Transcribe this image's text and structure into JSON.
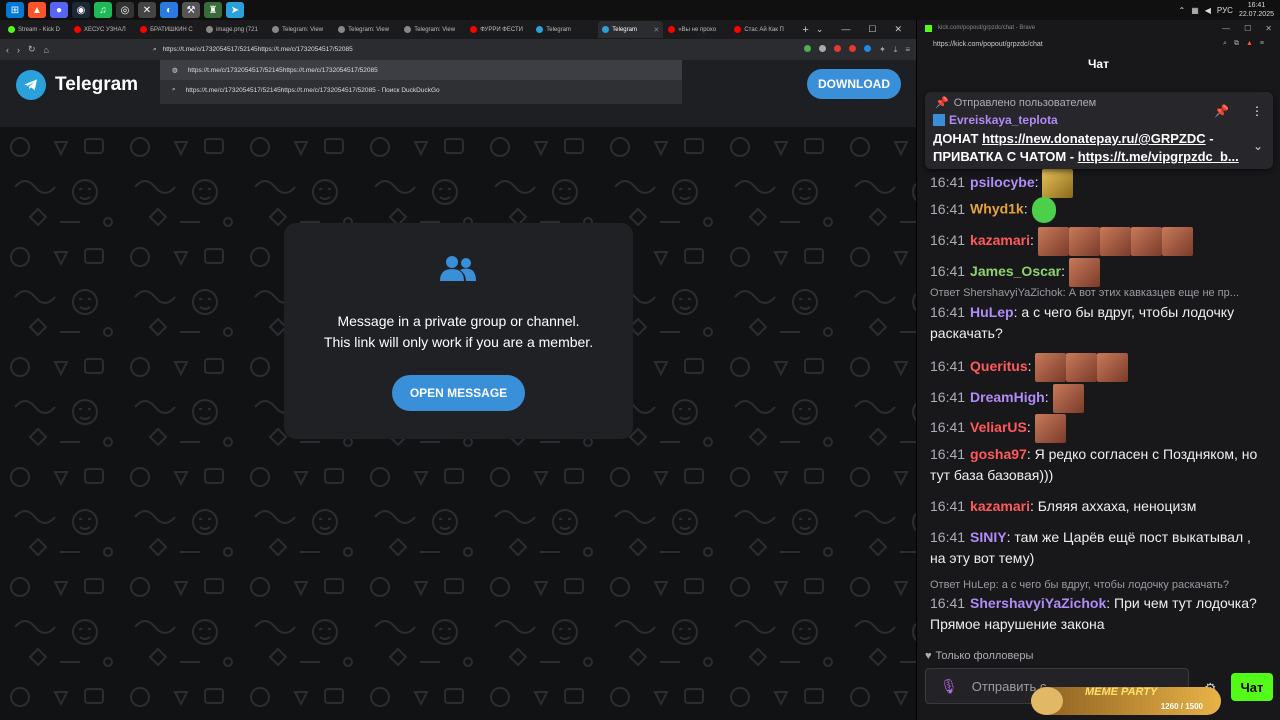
{
  "taskbar": {
    "time": "16:41",
    "date": "22.07.2025",
    "lang": "РУС"
  },
  "left_browser": {
    "tabs": [
      {
        "label": "Stream - Kick D",
        "color": "#53fc18"
      },
      {
        "label": "ХЕСУС УЗНАЛ",
        "color": "#ff0000"
      },
      {
        "label": "БРАТИШКИН С",
        "color": "#ff0000"
      },
      {
        "label": "image.png (721",
        "color": "#888888"
      },
      {
        "label": "Telegram: View",
        "color": "#888888"
      },
      {
        "label": "Telegram: View",
        "color": "#888888"
      },
      {
        "label": "Telegram: View",
        "color": "#888888"
      },
      {
        "label": "ФУРРИ ФЕСТИ",
        "color": "#ff0000"
      },
      {
        "label": "Telegram",
        "color": "#2aa1da"
      },
      {
        "label": "Telegram",
        "color": "#2aa1da"
      },
      {
        "label": "«Вы не прохо",
        "color": "#ff0000"
      },
      {
        "label": "Стас Ай Как П",
        "color": "#ff0000"
      }
    ],
    "address": "https://t.me/c/1732054517/52145https://t.me/c/1732054517/52085",
    "suggestions": [
      "https://t.me/c/1732054517/52145https://t.me/c/1732054517/52085",
      "https://t.me/c/1732054517/52145https://t.me/c/1732054517/52085 - Поиск DuckDuckGo"
    ],
    "page": {
      "brand": "Telegram",
      "download": "DOWNLOAD",
      "card_line1": "Message in a private group or channel.",
      "card_line2": "This link will only work if you are a member.",
      "open_button": "OPEN MESSAGE"
    }
  },
  "right_browser": {
    "title": "kick.com/popout/grpzdc/chat - Brave",
    "url": "https://kick.com/popout/grpzdc/chat",
    "chat_title": "Чат",
    "pinned": {
      "header": "Отправлено пользователем",
      "user": "Evreiskaya_teplota",
      "text_prefix": "ДОНАТ",
      "link1": "https://new.donatepay.ru/@GRPZDC",
      "text_mid": " - ПРИВАТКА С ЧАТОМ - ",
      "link2": "https://t.me/vipgrpzdc_b..."
    },
    "messages": [
      {
        "time": "16:41",
        "user": "psilocybe",
        "color": "#b08cf7",
        "text": "",
        "emotes": [
          "gold"
        ]
      },
      {
        "time": "16:41",
        "user": "Whyd1k",
        "color": "#e6a23c",
        "text": "",
        "emotes": [
          "green"
        ]
      },
      {
        "time": "16:41",
        "user": "kazamari",
        "color": "#ff5a5a",
        "text": "",
        "emotes": [
          "e",
          "e",
          "e",
          "e",
          "e"
        ]
      },
      {
        "time": "16:41",
        "user": "James_Oscar",
        "color": "#8fd16a",
        "text": "",
        "emotes": [
          "e"
        ]
      },
      {
        "time": "16:41",
        "user": "HuLep",
        "color": "#b08cf7",
        "text": "а с чего бы вдруг, чтобы лодочку раскачать?",
        "emotes": [],
        "reply": "Ответ ShershavyiYaZichok: А вот этих кавказцев еще не пр..."
      },
      {
        "time": "16:41",
        "user": "Queritus",
        "color": "#ff5a5a",
        "text": "",
        "emotes": [
          "e",
          "e",
          "e"
        ]
      },
      {
        "time": "16:41",
        "user": "DreamHigh",
        "color": "#b08cf7",
        "text": "",
        "emotes": [
          "e"
        ]
      },
      {
        "time": "16:41",
        "user": "VeliarUS",
        "color": "#ff5a5a",
        "text": "",
        "emotes": [
          "e"
        ]
      },
      {
        "time": "16:41",
        "user": "gosha97",
        "color": "#ff5a5a",
        "text": "Я редко согласен с Поздняком, но тут база базовая)))",
        "emotes": []
      },
      {
        "time": "16:41",
        "user": "kazamari",
        "color": "#ff5a5a",
        "text": "Бляяя аххаха, неноцизм",
        "emotes": []
      },
      {
        "time": "16:41",
        "user": "SINIY",
        "color": "#b08cf7",
        "text": "там же Царёв ещё пост выкатывал , на эту вот тему)",
        "emotes": []
      },
      {
        "time": "16:41",
        "user": "ShershavyiYaZichok",
        "color": "#b08cf7",
        "text": "При чем тут лодочка? Прямое нарушение закона",
        "emotes": [],
        "reply": "Ответ HuLep: а с чего бы вдруг, чтобы лодочку раскачать?"
      }
    ],
    "followers_only": "Только фолловеры",
    "input_placeholder": "Отправить с",
    "send": "Чат",
    "meme_party": {
      "title": "MEME PARTY",
      "count": "1260 / 1500"
    }
  }
}
